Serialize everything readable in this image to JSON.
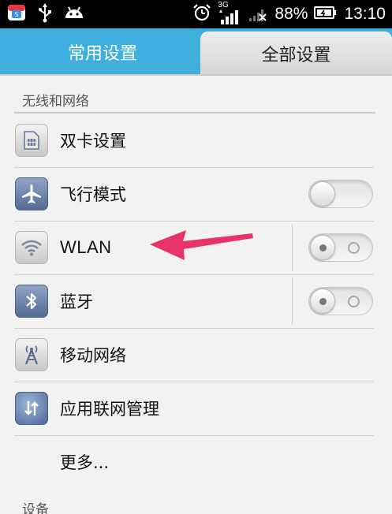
{
  "status_bar": {
    "network_type": "3G",
    "battery_percent": "88%",
    "time": "13:10",
    "left_icons": [
      "app-store-icon",
      "usb-icon",
      "android-icon"
    ],
    "right_icons": [
      "alarm-icon",
      "signal-icon",
      "no-signal-icon",
      "battery-charging-icon"
    ]
  },
  "tabs": [
    {
      "label": "常用设置",
      "active": true
    },
    {
      "label": "全部设置",
      "active": false
    }
  ],
  "sections": [
    {
      "header": "无线和网络",
      "items": [
        {
          "label": "双卡设置",
          "icon": "sim-card-icon"
        },
        {
          "label": "飞行模式",
          "icon": "airplane-icon",
          "toggle": "off"
        },
        {
          "label": "WLAN",
          "icon": "wifi-icon",
          "toggle": "off"
        },
        {
          "label": "蓝牙",
          "icon": "bluetooth-icon",
          "toggle": "off"
        },
        {
          "label": "移动网络",
          "icon": "antenna-icon"
        },
        {
          "label": "应用联网管理",
          "icon": "network-manager-icon"
        },
        {
          "label": "更多..."
        }
      ]
    },
    {
      "header": "设备",
      "items": []
    }
  ],
  "colors": {
    "tab_bar": "#3fb0de",
    "background": "#f2f2f2",
    "annotation_arrow": "#e8336a"
  }
}
